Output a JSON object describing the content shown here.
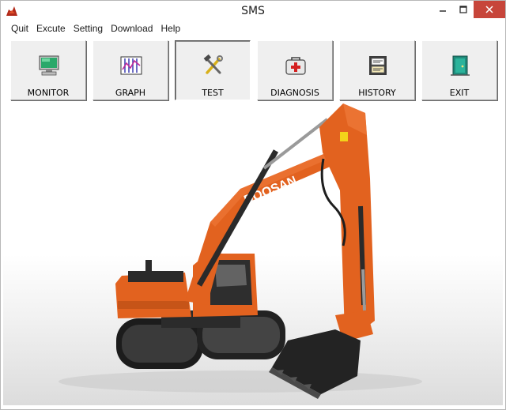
{
  "window": {
    "title": "SMS",
    "icons": {
      "app": "app-logo-icon",
      "minimize": "minimize-icon",
      "maximize": "maximize-icon",
      "close": "close-icon"
    }
  },
  "menu": {
    "items": [
      "Quit",
      "Excute",
      "Setting",
      "Download",
      "Help"
    ]
  },
  "toolbar": {
    "buttons": [
      {
        "label": "MONITOR",
        "icon": "monitor-icon"
      },
      {
        "label": "GRAPH",
        "icon": "graph-icon"
      },
      {
        "label": "TEST",
        "icon": "tools-icon",
        "pressed": true
      },
      {
        "label": "DIAGNOSIS",
        "icon": "medical-kit-icon"
      },
      {
        "label": "HISTORY",
        "icon": "history-icon"
      },
      {
        "label": "EXIT",
        "icon": "exit-door-icon"
      }
    ]
  },
  "hero": {
    "brand_text": "DOOSAN",
    "colors": {
      "body": "#e2621f",
      "dark": "#2a2a2a",
      "close_button": "#c7453a"
    }
  }
}
